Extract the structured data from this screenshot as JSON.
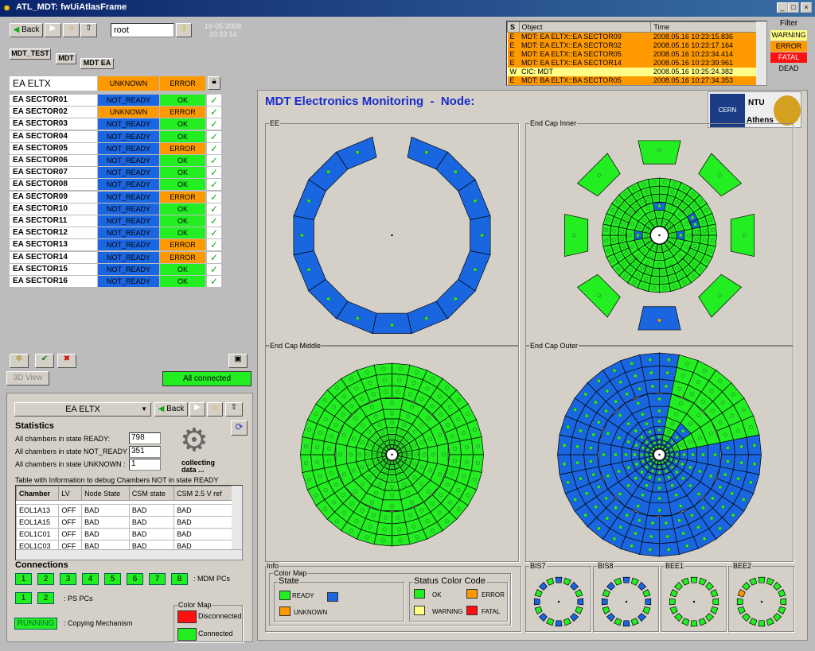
{
  "window": {
    "title": "ATL_MDT: fwUiAtlasFrame",
    "min": "_",
    "max": "□",
    "close": "×"
  },
  "toolbar": {
    "back": "Back",
    "user": "root",
    "date": "16-05-2008",
    "time": "10:33:14"
  },
  "breadcrumb": [
    "MDT_TEST",
    "MDT",
    "MDT EA"
  ],
  "node": {
    "name": "EA ELTX",
    "state": "UNKNOWN",
    "status": "ERROR"
  },
  "colors": {
    "ready": "#22ee22",
    "not_ready": "#1a66e0",
    "unknown": "#ff9900",
    "ok": "#22ee22",
    "error": "#ff9900",
    "warning": "#ffff88",
    "fatal": "#ff1010"
  },
  "sectors": [
    {
      "name": "EA SECTOR01",
      "state": "NOT_READY",
      "status": "OK"
    },
    {
      "name": "EA SECTOR02",
      "state": "UNKNOWN",
      "status": "ERROR"
    },
    {
      "name": "EA SECTOR03",
      "state": "NOT_READY",
      "status": "OK"
    },
    {
      "name": "EA SECTOR04",
      "state": "NOT_READY",
      "status": "OK"
    },
    {
      "name": "EA SECTOR05",
      "state": "NOT_READY",
      "status": "ERROR"
    },
    {
      "name": "EA SECTOR06",
      "state": "NOT_READY",
      "status": "OK"
    },
    {
      "name": "EA SECTOR07",
      "state": "NOT_READY",
      "status": "OK"
    },
    {
      "name": "EA SECTOR08",
      "state": "NOT_READY",
      "status": "OK"
    },
    {
      "name": "EA SECTOR09",
      "state": "NOT_READY",
      "status": "ERROR"
    },
    {
      "name": "EA SECTOR10",
      "state": "NOT_READY",
      "status": "OK"
    },
    {
      "name": "EA SECTOR11",
      "state": "NOT_READY",
      "status": "OK"
    },
    {
      "name": "EA SECTOR12",
      "state": "NOT_READY",
      "status": "OK"
    },
    {
      "name": "EA SECTOR13",
      "state": "NOT_READY",
      "status": "ERROR"
    },
    {
      "name": "EA SECTOR14",
      "state": "NOT_READY",
      "status": "ERROR"
    },
    {
      "name": "EA SECTOR15",
      "state": "NOT_READY",
      "status": "OK"
    },
    {
      "name": "EA SECTOR16",
      "state": "NOT_READY",
      "status": "OK"
    }
  ],
  "alarms": {
    "headers": [
      "S",
      "Object",
      "Time"
    ],
    "rows": [
      {
        "s": "E",
        "object": "MDT: EA ELTX::EA SECTOR09",
        "time": "2008.05.16 10:23:15.836",
        "level": "error"
      },
      {
        "s": "E",
        "object": "MDT: EA ELTX::EA SECTOR02",
        "time": "2008.05.16 10:23:17.164",
        "level": "error"
      },
      {
        "s": "E",
        "object": "MDT: EA ELTX::EA SECTOR05",
        "time": "2008.05.16 10:23:34.414",
        "level": "error"
      },
      {
        "s": "E",
        "object": "MDT: EA ELTX::EA SECTOR14",
        "time": "2008.05.16 10:23:39.961",
        "level": "error"
      },
      {
        "s": "W",
        "object": "CIC: MDT",
        "time": "2008.05.16 10:25:24.382",
        "level": "warning"
      },
      {
        "s": "E",
        "object": "MDT: BA ELTX::BA SECTOR05",
        "time": "2008.05.16 10:27:34.353",
        "level": "error"
      }
    ]
  },
  "filter": {
    "title": "Filter",
    "items": [
      "WARNING",
      "ERROR",
      "FATAL",
      "DEAD"
    ]
  },
  "controls": {
    "view3d": "3D View",
    "connection": "All connected"
  },
  "main": {
    "title": "MDT Electronics Monitoring  -  Node:",
    "logo_cern": "CERN",
    "logo_ntu": "NTU",
    "logo_athens": "Athens"
  },
  "wheels": [
    {
      "label": "EE",
      "type": "ee"
    },
    {
      "label": "End Cap Inner",
      "type": "inner"
    },
    {
      "label": "End Cap Middle",
      "type": "middle"
    },
    {
      "label": "End Cap Outer",
      "type": "outer"
    }
  ],
  "small_wheels": [
    "BIS7",
    "BIS8",
    "BEE1",
    "BEE2"
  ],
  "info": {
    "title": "Info",
    "colormap": "Color Map",
    "state": "State",
    "ready": "READY",
    "unknown": "UNKNOWN",
    "status_code": "Status Color Code",
    "ok": "OK",
    "error": "ERROR",
    "warning": "WARNING",
    "fatal": "FATAL"
  },
  "stats": {
    "selector": "EA ELTX",
    "back": "Back",
    "title": "Statistics",
    "ready_label": "All chambers in state READY:",
    "ready": "798",
    "not_ready_label": "All chambers in state NOT_READY",
    "not_ready": "351",
    "unknown_label": "All chambers in state UNKNOWN :",
    "unknown": "1",
    "collecting": "collecting data ...",
    "table_caption": "Table with Information to debug Chambers NOT in state READY",
    "headers": [
      "Chamber",
      "LV",
      "Node State",
      "CSM state",
      "CSM 2.5 V ref"
    ],
    "rows": [
      [
        "EOL1A13",
        "OFF",
        "BAD",
        "BAD",
        "BAD"
      ],
      [
        "EOL1A15",
        "OFF",
        "BAD",
        "BAD",
        "BAD"
      ],
      [
        "EOL1C01",
        "OFF",
        "BAD",
        "BAD",
        "BAD"
      ],
      [
        "EOL1C03",
        "OFF",
        "BAD",
        "BAD",
        "BAD"
      ]
    ]
  },
  "connections": {
    "title": "Connections",
    "mdm": [
      "1",
      "2",
      "3",
      "4",
      "5",
      "6",
      "7",
      "8"
    ],
    "mdm_label": ": MDM PCs",
    "ps": [
      "1",
      "2"
    ],
    "ps_label": ": PS PCs",
    "copy": "RUNNING",
    "copy_label": ": Copying Mechanism",
    "colormap": "Color Map",
    "disconnected": "Disconnected",
    "connected": "Connected"
  }
}
